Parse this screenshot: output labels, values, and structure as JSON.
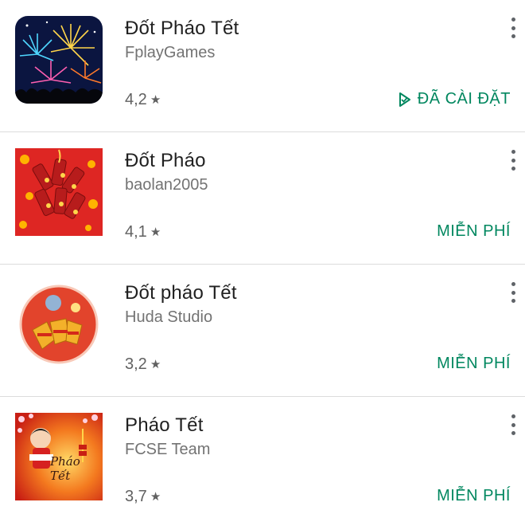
{
  "apps": [
    {
      "title": "Đốt Pháo Tết",
      "developer": "FplayGames",
      "rating": "4,2",
      "action": "ĐÃ CÀI ĐẶT",
      "icon": "fireworks-icon"
    },
    {
      "title": "Đốt Pháo",
      "developer": "baolan2005",
      "rating": "4,1",
      "action": "MIỄN PHÍ",
      "icon": "firecrackers-icon"
    },
    {
      "title": "Đốt pháo Tết",
      "developer": "Huda Studio",
      "rating": "3,2",
      "action": "MIỄN PHÍ",
      "icon": "firecracker-bundle-icon"
    },
    {
      "title": "Pháo Tết",
      "developer": "FCSE Team",
      "rating": "3,7",
      "action": "MIỄN PHÍ",
      "icon": "phao-tet-icon",
      "icon_text": "Pháo Tết"
    }
  ],
  "colors": {
    "action_green": "#01875f",
    "divider": "#dcdcdc",
    "title_text": "#212121",
    "secondary_text": "#737373"
  },
  "symbols": {
    "star": "★"
  }
}
